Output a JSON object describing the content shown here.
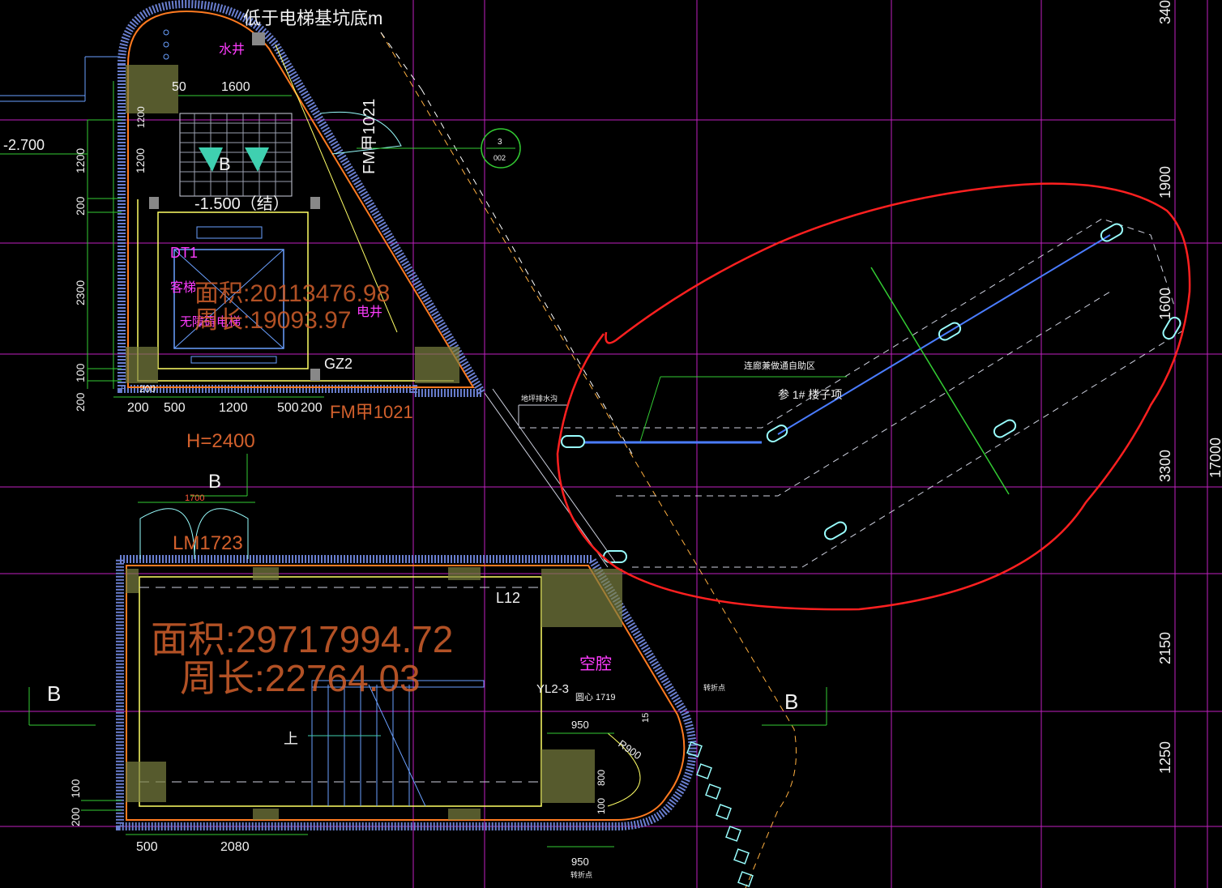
{
  "drawing": {
    "pit_note": "低于电梯基坑底m",
    "water_well": "水井",
    "elec_well": "电井",
    "elevator_code": "DT1",
    "elevator_type": "客梯",
    "elevator_desc": "无障碍电梯",
    "level_pit": "-1.500（结）",
    "level_left": "-2.700",
    "door_top": "FM甲1021",
    "door_bottom": "FM甲1021",
    "gz2": "GZ2",
    "h_value": "H=2400",
    "lm1723": "LM1723",
    "l12": "L12",
    "void": "空腔",
    "yl23": "YL2-3",
    "arc_note": "圆心 1719",
    "r900": "R900",
    "up": "上",
    "section_mark": "B",
    "ref_circle_top": "3",
    "ref_circle_bottom": "002",
    "note_corridor": "连廊兼做通自助区",
    "note_ref": "参 1# 楼子项",
    "note_small_left": "地坪排水沟",
    "note_small_bottom": "转折点",
    "note_small_right": "转折点"
  },
  "measurements": {
    "area1": "面积:20113476.98",
    "perim1": "周长:19093.97",
    "area2": "面积:29717994.72",
    "perim2": "周长:22764.03"
  },
  "dims": {
    "top_50": "50",
    "top_1600": "1600",
    "left_1200a": "1200",
    "left_1200b": "1200",
    "left_200a": "200",
    "left_2300": "2300",
    "left_100": "100",
    "left_200b": "200",
    "inner_1200": "1200",
    "inner_200": "200",
    "bot_200a": "200",
    "bot_500a": "500",
    "bot_1200": "1200",
    "bot_500b": "500",
    "bot_200b": "200",
    "dim_1700": "1700",
    "dim_950a": "950",
    "dim_950b": "950",
    "dim_800": "800",
    "dim_100c": "100",
    "dim_15": "15",
    "low_100": "100",
    "low_200": "200",
    "low_500": "500",
    "low_2080": "2080",
    "right_340": "340",
    "right_1900": "1900",
    "right_1600": "1600",
    "right_3300": "3300",
    "right_17000": "17000",
    "right_2150": "2150",
    "right_1250": "1250"
  }
}
